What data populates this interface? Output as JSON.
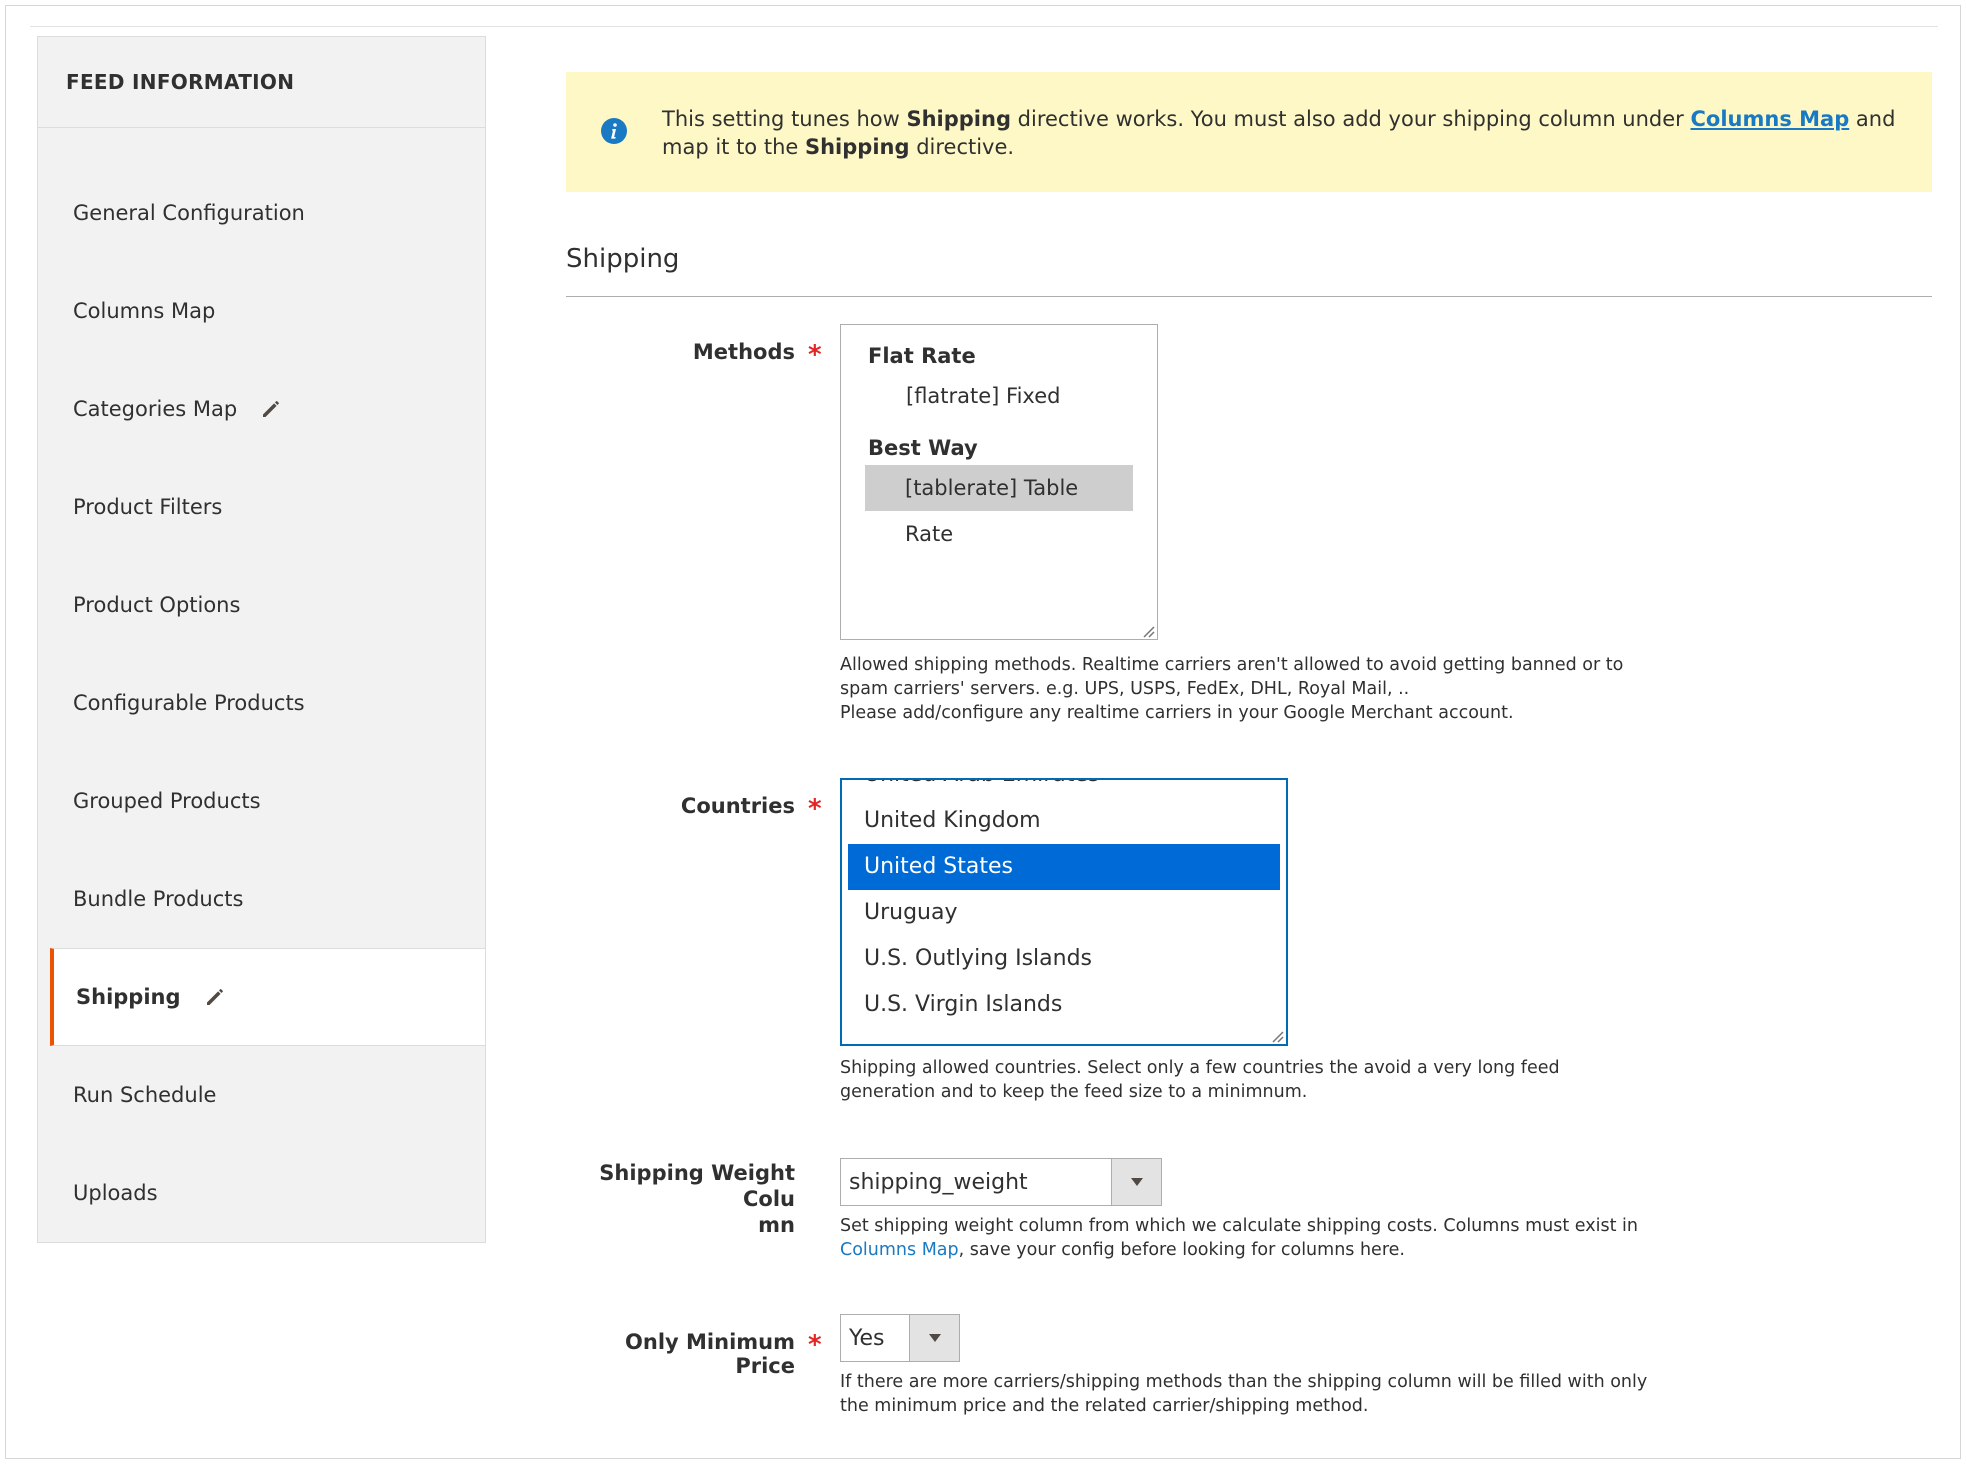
{
  "sidebar": {
    "title": "FEED INFORMATION",
    "items": [
      {
        "label": "General Configuration"
      },
      {
        "label": "Columns Map"
      },
      {
        "label": "Categories Map"
      },
      {
        "label": "Product Filters"
      },
      {
        "label": "Product Options"
      },
      {
        "label": "Configurable Products"
      },
      {
        "label": "Grouped Products"
      },
      {
        "label": "Bundle Products"
      },
      {
        "label": "Shipping"
      },
      {
        "label": "Run Schedule"
      },
      {
        "label": "Uploads"
      }
    ]
  },
  "notice": {
    "text_1": "This setting tunes how ",
    "bold_1": "Shipping",
    "text_2": " directive works. You must also add your shipping column under ",
    "link": "Columns Map",
    "text_3": " and map it to the ",
    "bold_2": "Shipping",
    "text_4": " directive."
  },
  "section": {
    "title": "Shipping"
  },
  "methods": {
    "label": "Methods",
    "groups": [
      {
        "name": "Flat Rate",
        "options": [
          "[flatrate] Fixed"
        ]
      },
      {
        "name": "Best Way",
        "options": [
          "[tablerate] Table Rate"
        ]
      }
    ],
    "selected": "[tablerate] Table Rate",
    "note_line_1": "Allowed shipping methods. Realtime carriers aren't allowed to avoid getting banned or to spam carriers' servers. e.g. UPS, USPS, FedEx, DHL, Royal Mail, ..",
    "note_line_2": "Please add/configure any realtime carriers in your Google Merchant account."
  },
  "countries": {
    "label": "Countries",
    "options": [
      "United Arab Emirates",
      "United Kingdom",
      "United States",
      "Uruguay",
      "U.S. Outlying Islands",
      "U.S. Virgin Islands"
    ],
    "selected": "United States",
    "note": "Shipping allowed countries. Select only a few countries the avoid a very long feed generation and to keep the feed size to a minimnum."
  },
  "weight_column": {
    "label_line_1": "Shipping Weight Colu",
    "label_line_2": "mn",
    "value": "shipping_weight",
    "note_text_1": "Set shipping weight column from which we calculate shipping costs. Columns must exist in ",
    "note_link": "Columns Map",
    "note_text_2": ", save your config before looking for columns here."
  },
  "min_price": {
    "label": "Only Minimum Price",
    "value": "Yes",
    "note": "If there are more carriers/shipping methods than the shipping column will be filled with only the minimum price and the related carrier/shipping method."
  },
  "colors": {
    "accent": "#eb5202",
    "link": "#1979c3",
    "selected": "#006bd6",
    "notice_bg": "#fdf8c6",
    "required": "#e22626"
  }
}
